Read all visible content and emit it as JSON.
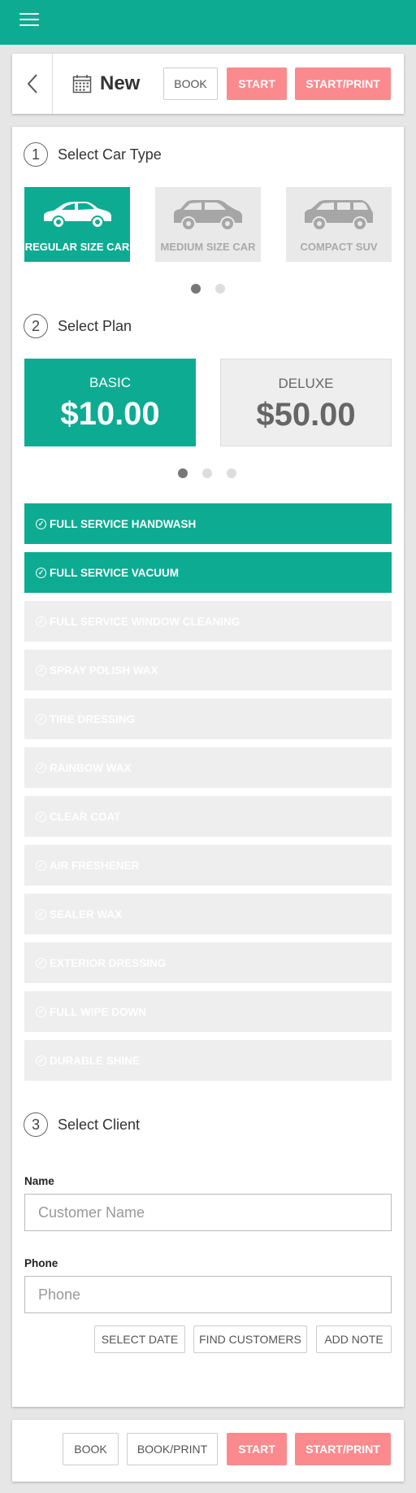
{
  "colors": {
    "primary": "#0eab93",
    "accent": "#fb8a8e",
    "inactive": "#eeeeee"
  },
  "appbar": {
    "menu_icon": "hamburger-menu-icon"
  },
  "header": {
    "back_icon": "chevron-left-icon",
    "calendar_icon": "calendar-icon",
    "title": "New",
    "buttons": {
      "book": "BOOK",
      "start": "START",
      "start_print": "START/PRINT"
    }
  },
  "car_type": {
    "step": "1",
    "title": "Select Car Type",
    "options": [
      {
        "label": "REGULAR SIZE CAR",
        "icon": "sedan-car-icon",
        "selected": true
      },
      {
        "label": "MEDIUM SIZE CAR",
        "icon": "suv-car-icon",
        "selected": false
      },
      {
        "label": "COMPACT SUV",
        "icon": "wagon-car-icon",
        "selected": false
      }
    ],
    "pager": {
      "pages": 2,
      "current": 1
    }
  },
  "plan": {
    "step": "2",
    "title": "Select Plan",
    "options": [
      {
        "name": "BASIC",
        "price": "$10.00",
        "selected": true
      },
      {
        "name": "DELUXE",
        "price": "$50.00",
        "selected": false
      }
    ],
    "pager": {
      "pages": 3,
      "current": 1
    }
  },
  "services": [
    {
      "label": "FULL SERVICE HANDWASH",
      "included": true
    },
    {
      "label": "FULL SERVICE VACUUM",
      "included": true
    },
    {
      "label": "FULL SERVICE WINDOW CLEANING",
      "included": false
    },
    {
      "label": "SPRAY POLISH WAX",
      "included": false
    },
    {
      "label": "TIRE DRESSING",
      "included": false
    },
    {
      "label": "RAINBOW WAX",
      "included": false
    },
    {
      "label": "CLEAR COAT",
      "included": false
    },
    {
      "label": "AIR FRESHENER",
      "included": false
    },
    {
      "label": "SEALER WAX",
      "included": false
    },
    {
      "label": "EXTERIOR DRESSING",
      "included": false
    },
    {
      "label": "FULL WIPE DOWN",
      "included": false
    },
    {
      "label": "DURABLE SHINE",
      "included": false
    }
  ],
  "client": {
    "step": "3",
    "title": "Select Client",
    "name_label": "Name",
    "name_placeholder": "Customer Name",
    "name_value": "",
    "phone_label": "Phone",
    "phone_placeholder": "Phone",
    "phone_value": "",
    "buttons": {
      "select_date": "SELECT DATE",
      "find_customers": "FIND CUSTOMERS",
      "add_note": "ADD NOTE"
    }
  },
  "footer": {
    "buttons": {
      "book": "BOOK",
      "book_print": "BOOK/PRINT",
      "start": "START",
      "start_print": "START/PRINT"
    }
  }
}
